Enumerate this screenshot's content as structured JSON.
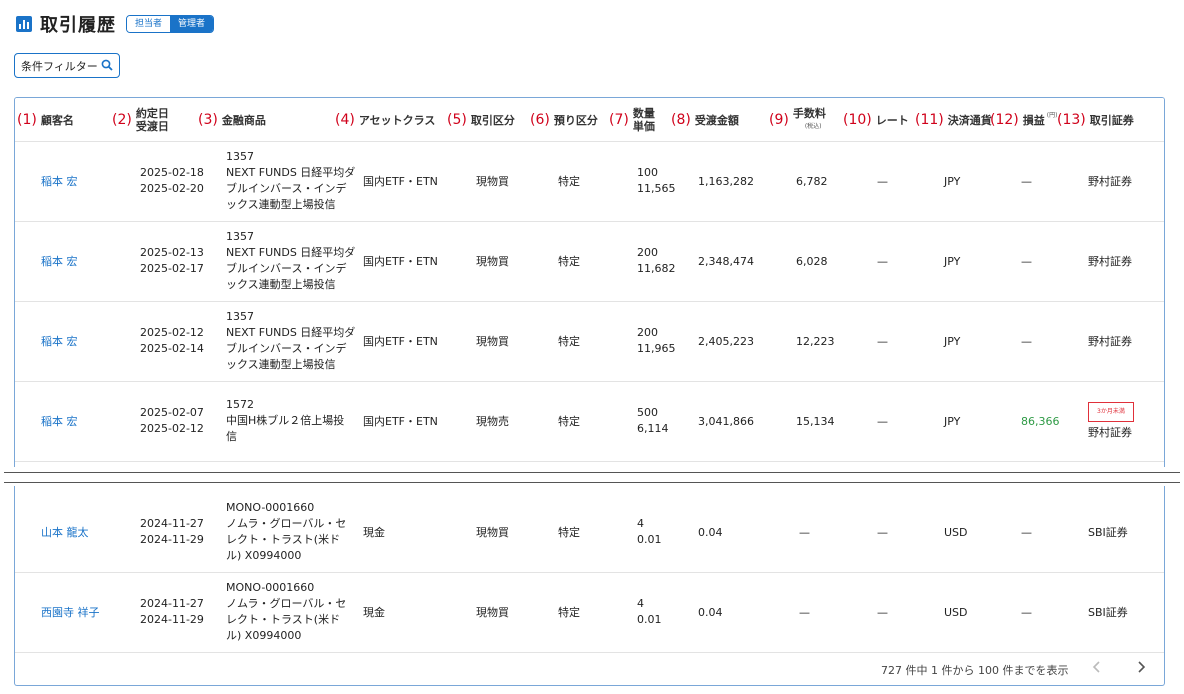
{
  "header": {
    "title": "取引履歴",
    "role_tabs": [
      "担当者",
      "管理者"
    ]
  },
  "filter": {
    "label": "条件フィルター"
  },
  "columns": [
    {
      "num": "(1)",
      "label": "顧客名"
    },
    {
      "num": "(2)",
      "label": "約定日",
      "label2": "受渡日"
    },
    {
      "num": "(3)",
      "label": "金融商品"
    },
    {
      "num": "(4)",
      "label": "アセットクラス"
    },
    {
      "num": "(5)",
      "label": "取引区分"
    },
    {
      "num": "(6)",
      "label": "預り区分"
    },
    {
      "num": "(7)",
      "label": "数量",
      "label2": "単価"
    },
    {
      "num": "(8)",
      "label": "受渡金額"
    },
    {
      "num": "(9)",
      "label": "手数料",
      "note": "(税込)"
    },
    {
      "num": "(10)",
      "label": "レート"
    },
    {
      "num": "(11)",
      "label": "決済通貨"
    },
    {
      "num": "(12)",
      "label": "損益",
      "note": "(円)"
    },
    {
      "num": "(13)",
      "label": "取引証券"
    }
  ],
  "rows_top": [
    {
      "customer": "稲本 宏",
      "trade_date": "2025-02-18",
      "settle_date": "2025-02-20",
      "product": [
        "1357",
        "NEXT FUNDS 日経平均ダ",
        "ブルインバース・インデ",
        "ックス連動型上場投信"
      ],
      "asset": "国内ETF・ETN",
      "trade_type": "現物買",
      "custody": "特定",
      "qty": "100",
      "price": "11,565",
      "amount": "1,163,282",
      "fee": "6,782",
      "rate": "—",
      "currency": "JPY",
      "profit": "—",
      "broker": "野村証券",
      "badge": ""
    },
    {
      "customer": "稲本 宏",
      "trade_date": "2025-02-13",
      "settle_date": "2025-02-17",
      "product": [
        "1357",
        "NEXT FUNDS 日経平均ダ",
        "ブルインバース・インデ",
        "ックス連動型上場投信"
      ],
      "asset": "国内ETF・ETN",
      "trade_type": "現物買",
      "custody": "特定",
      "qty": "200",
      "price": "11,682",
      "amount": "2,348,474",
      "fee": "6,028",
      "rate": "—",
      "currency": "JPY",
      "profit": "—",
      "broker": "野村証券",
      "badge": ""
    },
    {
      "customer": "稲本 宏",
      "trade_date": "2025-02-12",
      "settle_date": "2025-02-14",
      "product": [
        "1357",
        "NEXT FUNDS 日経平均ダ",
        "ブルインバース・インデ",
        "ックス連動型上場投信"
      ],
      "asset": "国内ETF・ETN",
      "trade_type": "現物買",
      "custody": "特定",
      "qty": "200",
      "price": "11,965",
      "amount": "2,405,223",
      "fee": "12,223",
      "rate": "—",
      "currency": "JPY",
      "profit": "—",
      "broker": "野村証券",
      "badge": ""
    },
    {
      "customer": "稲本 宏",
      "trade_date": "2025-02-07",
      "settle_date": "2025-02-12",
      "product": [
        "1572",
        "中国H株ブル２倍上場投",
        "信"
      ],
      "asset": "国内ETF・ETN",
      "trade_type": "現物売",
      "custody": "特定",
      "qty": "500",
      "price": "6,114",
      "amount": "3,041,866",
      "fee": "15,134",
      "rate": "—",
      "currency": "JPY",
      "profit": "86,366",
      "broker": "野村証券",
      "badge": "3か月未満"
    }
  ],
  "rows_bottom": [
    {
      "customer": "山本 龍太",
      "trade_date": "2024-11-27",
      "settle_date": "2024-11-29",
      "product": [
        "MONO-0001660",
        "ノムラ・グローバル・セ",
        "レクト・トラスト(米ド",
        "ル) X0994000"
      ],
      "asset": "現金",
      "trade_type": "現物買",
      "custody": "特定",
      "qty": "4",
      "price": "0.01",
      "amount": "0.04",
      "fee": "—",
      "rate": "—",
      "currency": "USD",
      "profit": "—",
      "broker": "SBI証券",
      "badge": ""
    },
    {
      "customer": "西園寺 祥子",
      "trade_date": "2024-11-27",
      "settle_date": "2024-11-29",
      "product": [
        "MONO-0001660",
        "ノムラ・グローバル・セ",
        "レクト・トラスト(米ド",
        "ル) X0994000"
      ],
      "asset": "現金",
      "trade_type": "現物買",
      "custody": "特定",
      "qty": "4",
      "price": "0.01",
      "amount": "0.04",
      "fee": "—",
      "rate": "—",
      "currency": "USD",
      "profit": "—",
      "broker": "SBI証券",
      "badge": ""
    }
  ],
  "pager": {
    "text": "727 件中 1 件から 100 件までを表示"
  },
  "colors": {
    "accent": "#1a73c8",
    "annotation": "#d0021b",
    "profit": "#2e9a45"
  }
}
